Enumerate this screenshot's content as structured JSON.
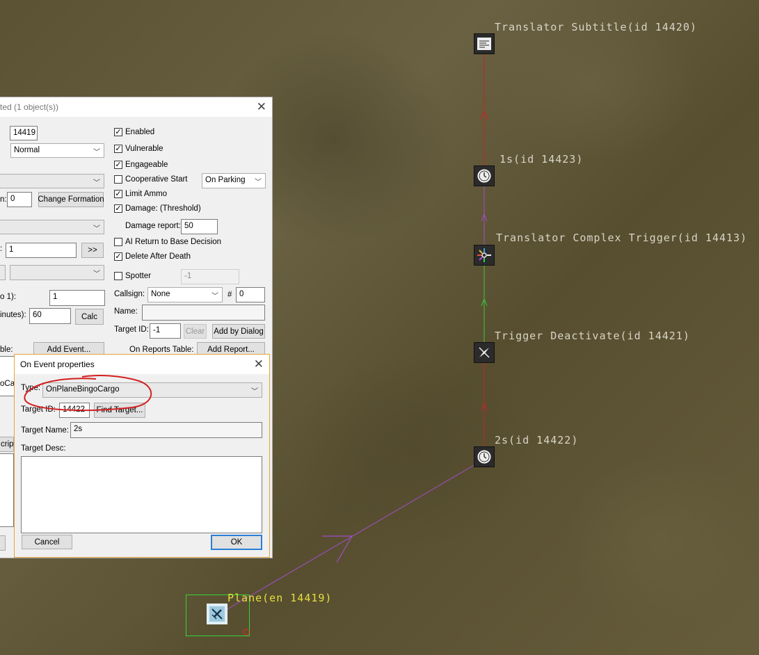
{
  "map": {
    "labels": {
      "subtitle": "Translator Subtitle(id 14420)",
      "timer1": "1s(id 14423)",
      "complex": "Translator Complex Trigger(id 14413)",
      "deactivate": "Trigger Deactivate(id 14421)",
      "timer2": "2s(id 14422)",
      "plane": "Plane(en 14419)"
    },
    "colors": {
      "red_link": "#c62424",
      "purple_link": "#a24ec9",
      "green_link": "#37c93b",
      "plane_label": "#e6e03a",
      "selection": "#35d435"
    }
  },
  "main_dialog": {
    "title": "ted (1 object(s))",
    "id_value": "14419",
    "skill_select": "Normal",
    "partial_label_n": "n:",
    "formation_value": "0",
    "change_formation_button": "Change Formation",
    "num_value": "1",
    "more_button": ">>",
    "partial_label_to1": "o 1):",
    "to1_value": "1",
    "partial_label_minutes": "inutes):",
    "minutes_value": "60",
    "calc_button": "Calc",
    "partial_label_table": "ble:",
    "add_event_button": "Add Event...",
    "on_reports_label": "On Reports Table:",
    "add_report_button": "Add Report...",
    "partial_row_1": "oCa",
    "partial_row_2": "cript",
    "enabled": "Enabled",
    "vulnerable": "Vulnerable",
    "engageable": "Engageable",
    "cooperative_start": "Cooperative Start",
    "coop_select": "On Parking",
    "limit_ammo": "Limit Ammo",
    "damage_threshold": "Damage: (Threshold)",
    "damage_report_label": "Damage report:",
    "damage_report_value": "50",
    "ai_return": "AI Return to Base Decision",
    "delete_after_death": "Delete After Death",
    "spotter": "Spotter",
    "spotter_value": "-1",
    "callsign_label": "Callsign:",
    "callsign_select": "None",
    "hash_label": "#",
    "callsign_num": "0",
    "name_label": "Name:",
    "name_value": "",
    "target_id_label": "Target ID:",
    "target_id_value": "-1",
    "clear_button": "Clear",
    "add_by_dialog_button": "Add by Dialog",
    "checks": {
      "enabled": true,
      "vulnerable": true,
      "engageable": true,
      "cooperative_start": false,
      "limit_ammo": true,
      "damage_threshold": true,
      "ai_return": false,
      "delete_after_death": true,
      "spotter": false
    }
  },
  "event_dialog": {
    "title": "On Event properties",
    "type_label": "Type:",
    "type_value": "OnPlaneBingoCargo",
    "target_id_label": "Target ID:",
    "target_id_value": "14422",
    "find_target_button": "Find Target...",
    "target_name_label": "Target Name:",
    "target_name_value": "2s",
    "target_desc_label": "Target Desc:",
    "cancel_button": "Cancel",
    "ok_button": "OK"
  },
  "icons": {
    "close": "close-icon",
    "dropdown": "chevron-down-icon",
    "check": "check-icon",
    "subtitle": "subtitle-icon",
    "timer": "clock-icon",
    "complex_trigger": "complex-trigger-icon",
    "deactivate": "trigger-deactivate-icon",
    "plane": "plane-icon"
  }
}
